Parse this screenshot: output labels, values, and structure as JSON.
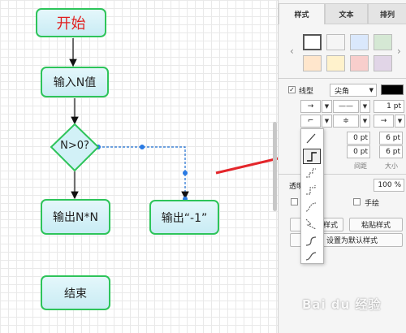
{
  "canvas": {
    "nodes": {
      "start": "开始",
      "input": "输入N值",
      "condition": "N>0?",
      "output_n": "输出N*N",
      "output_neg": "输出“-1”",
      "end": "结束"
    }
  },
  "panel": {
    "tabs": [
      "样式",
      "文本",
      "排列"
    ],
    "swatch_colors": [
      "#ffffff",
      "#f5f5f5",
      "#dae8fc",
      "#d5e8d4",
      "#ffe6cc",
      "#fff2cc",
      "#f8cecc",
      "#e1d5e7"
    ],
    "line": {
      "label": "线型",
      "checked": true,
      "style_value": "尖角",
      "color": "#000000",
      "width": "1 pt"
    },
    "spacing": {
      "values": [
        "0 pt",
        "6 pt",
        "0 pt",
        "6 pt"
      ],
      "spacing_label": "间距",
      "size_label": "大小"
    },
    "opacity": {
      "label": "透明",
      "value": "100 %"
    },
    "sketch_label": "手绘",
    "buttons": {
      "copy_style": "样式",
      "paste_style": "粘贴样式",
      "set_default": "设置为默认样式"
    }
  },
  "watermark": "Bai du 经验"
}
